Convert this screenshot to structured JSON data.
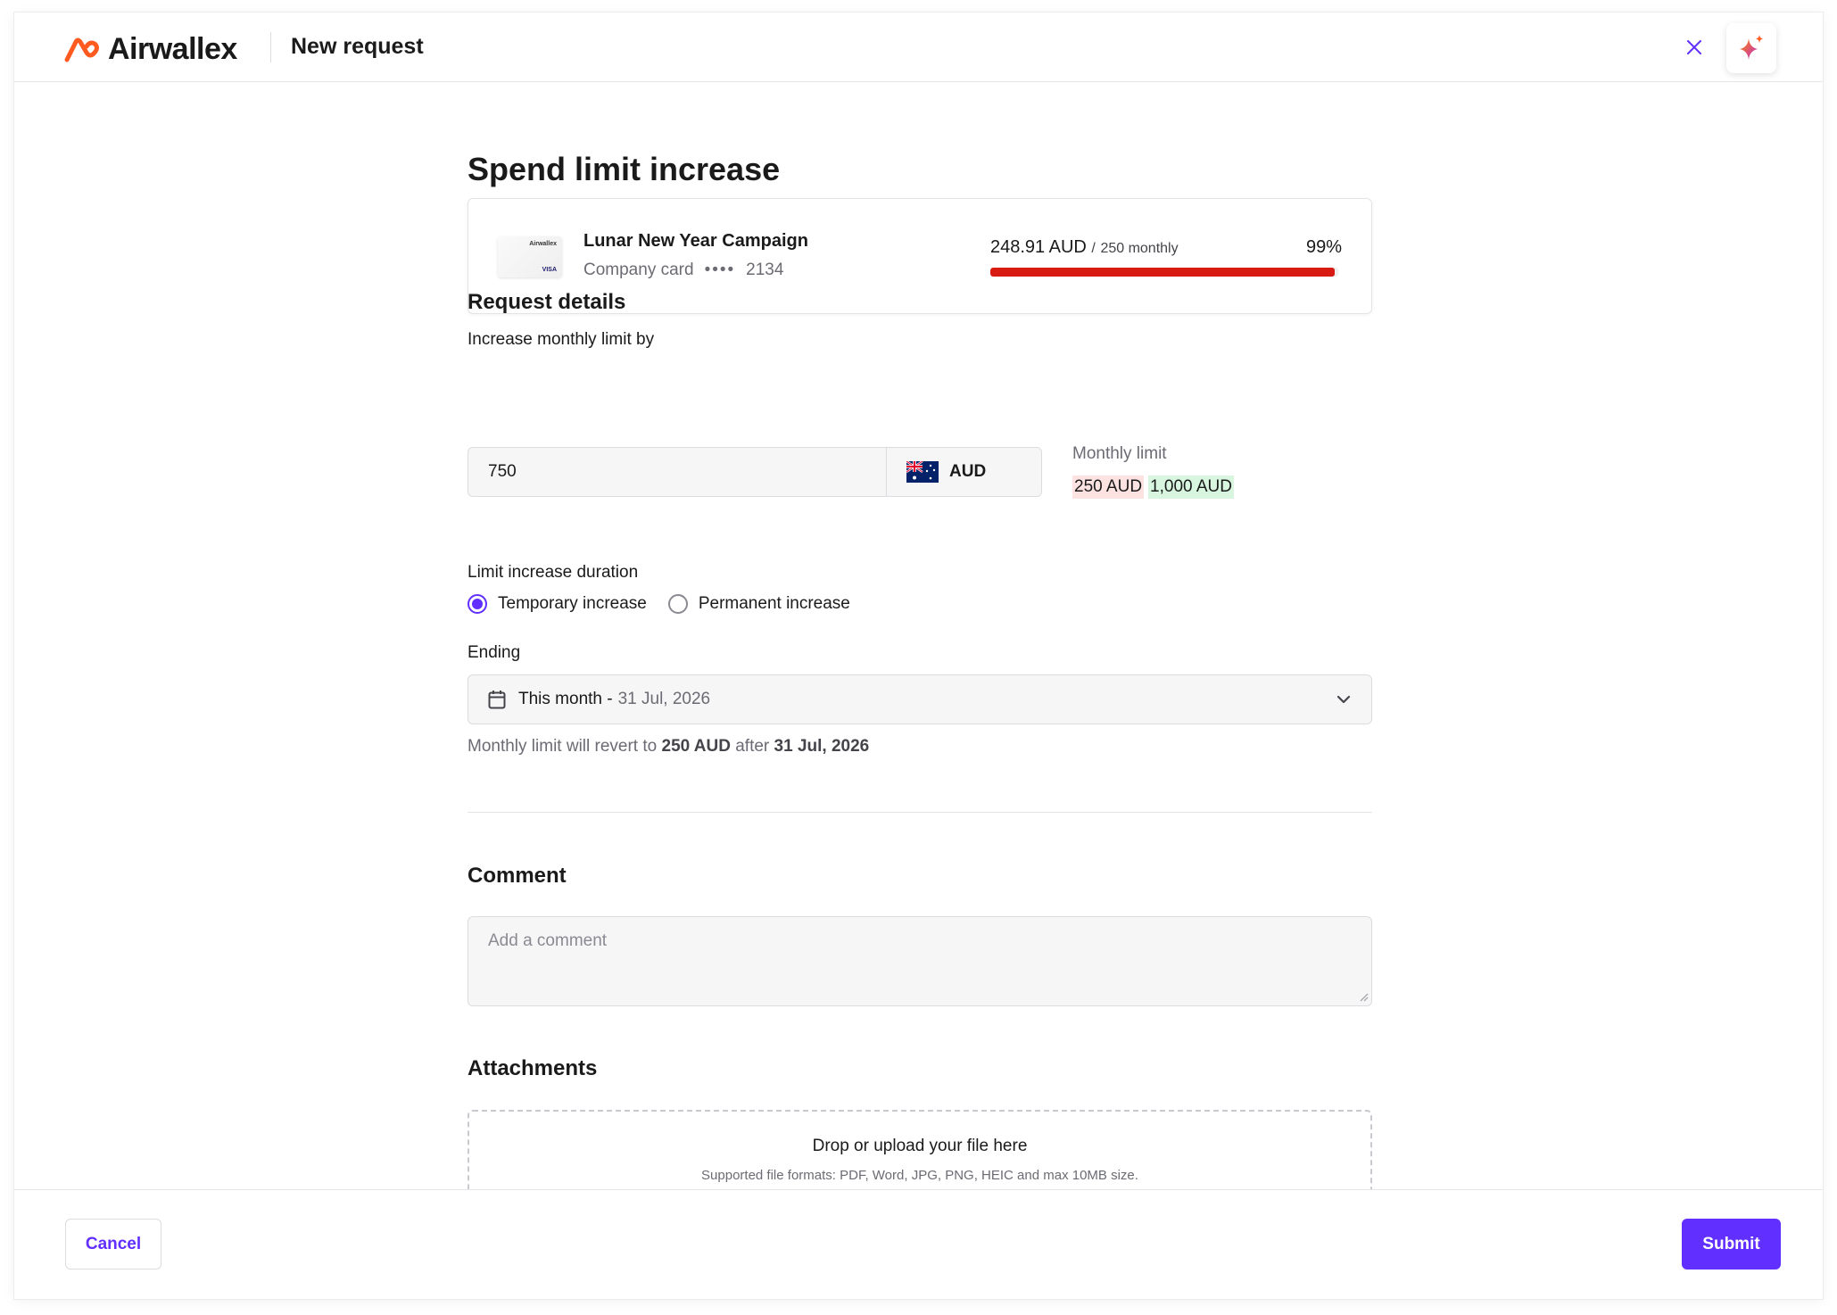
{
  "header": {
    "brand": "Airwallex",
    "title": "New request",
    "close_icon": "close-icon",
    "assistant_icon": "sparkle-icon"
  },
  "page": {
    "title": "Spend limit increase"
  },
  "card": {
    "name": "Lunar New Year Campaign",
    "type": "Company card",
    "masked": "••••",
    "last4": "2134",
    "spent": "248.91 AUD",
    "separator": "/",
    "limit_text": "250 monthly",
    "percent_text": "99%",
    "usage_fraction": 0.99,
    "progress_color": "#d81b12"
  },
  "request_details": {
    "title": "Request details",
    "increase_label": "Increase monthly limit by",
    "amount_value": "750",
    "currency": "AUD",
    "currency_flag": "australia-flag-icon",
    "monthly_limit_label": "Monthly limit",
    "old_limit": "250 AUD",
    "new_limit": "1,000 AUD"
  },
  "duration": {
    "label": "Limit increase duration",
    "options": [
      {
        "label": "Temporary increase",
        "checked": true
      },
      {
        "label": "Permanent increase",
        "checked": false
      }
    ],
    "ending_label": "Ending",
    "ending_value": "This month -",
    "ending_date": "31 Jul, 2026",
    "revert_prefix": "Monthly limit will revert to",
    "revert_amount": "250 AUD",
    "revert_mid": "after",
    "revert_date": "31 Jul, 2026"
  },
  "comment": {
    "title": "Comment",
    "placeholder": "Add a comment"
  },
  "attachments": {
    "title": "Attachments",
    "drop_text": "Drop or upload your file here",
    "formats_text": "Supported file formats: PDF, Word, JPG,  PNG, HEIC and max 10MB size."
  },
  "footer": {
    "cancel_label": "Cancel",
    "submit_label": "Submit"
  },
  "colors": {
    "accent": "#612fff",
    "brand_orange": "#ff5a1f",
    "danger": "#d81b12",
    "limit_old_bg": "#fde2e2",
    "limit_new_bg": "#d7f5df"
  }
}
